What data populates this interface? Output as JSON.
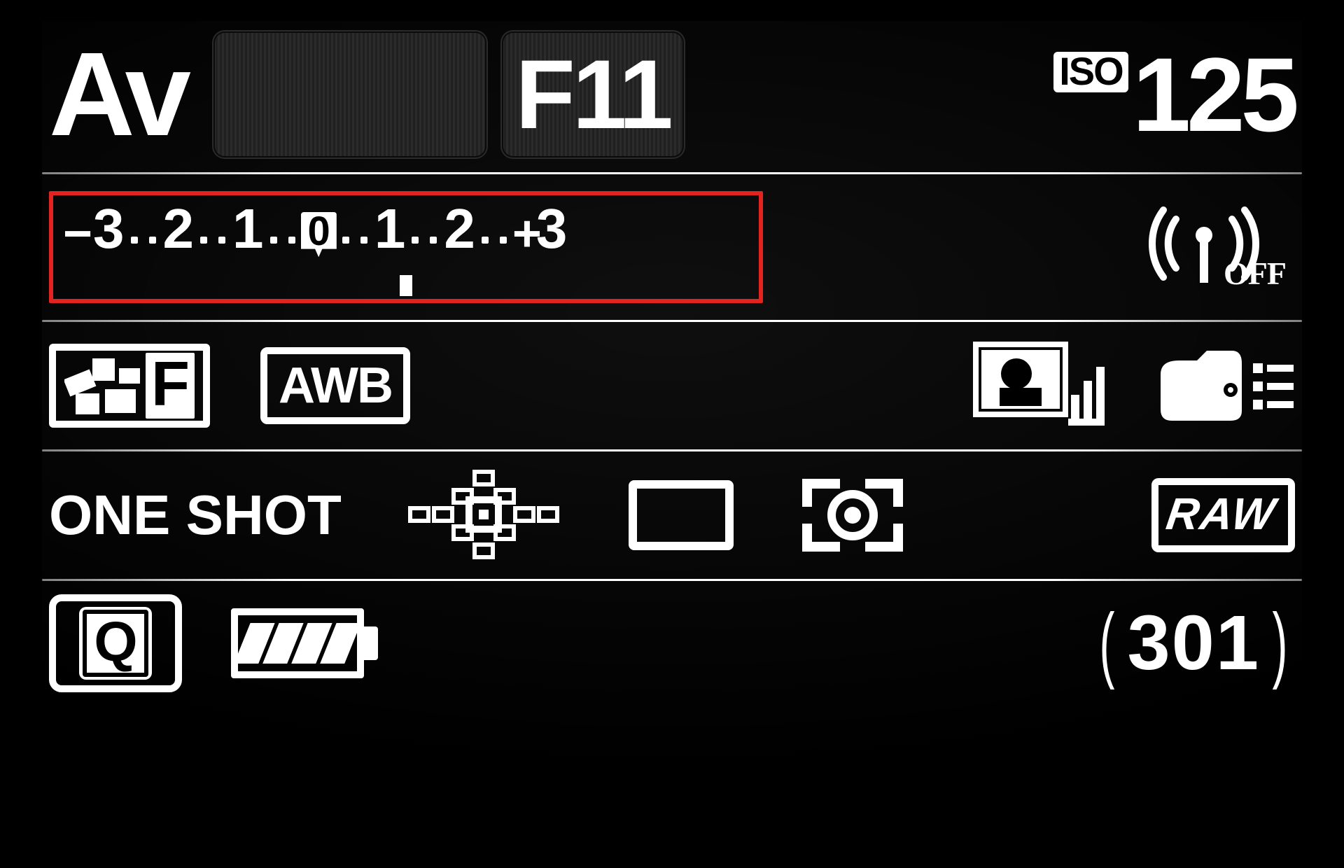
{
  "topRow": {
    "mode": "Av",
    "shutter": "",
    "aperture": "F11",
    "isoLabel": "ISO",
    "isoValue": "125"
  },
  "exposureCompensation": {
    "minusSign": "−",
    "plusSign": "+",
    "scale": [
      "3",
      "2",
      "1",
      "0",
      "1",
      "2",
      "3"
    ],
    "indicatorPosition": 0,
    "highlighted": true
  },
  "wireless": {
    "status": "OFF"
  },
  "row3": {
    "pictureStyleSuffix": "F",
    "whiteBalance": "AWB"
  },
  "row4": {
    "afMode": "ONE SHOT",
    "imageQuality": "RAW"
  },
  "row5": {
    "quickLabel": "Q",
    "batteryBars": 4,
    "shotsRemaining": "301"
  }
}
